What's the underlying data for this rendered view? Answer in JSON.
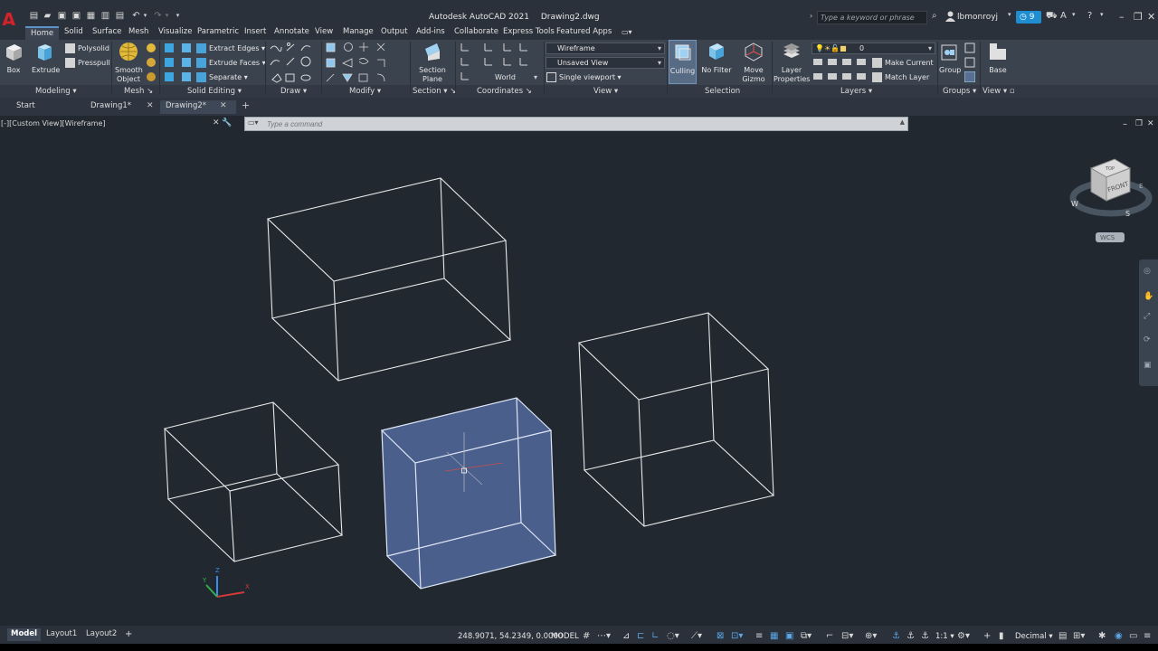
{
  "title_bar": {
    "app_name": "Autodesk AutoCAD 2021",
    "document": "Drawing2.dwg",
    "search_placeholder": "Type a keyword or phrase",
    "user": "lbmonroyj",
    "notifications": "9"
  },
  "ribbon_tabs": [
    "Home",
    "Solid",
    "Surface",
    "Mesh",
    "Visualize",
    "Parametric",
    "Insert",
    "Annotate",
    "View",
    "Manage",
    "Output",
    "Add-ins",
    "Collaborate",
    "Express Tools",
    "Featured Apps"
  ],
  "ribbon": {
    "modeling": {
      "title": "Modeling",
      "box": "Box",
      "extrude": "Extrude",
      "polysolid": "Polysolid",
      "presspull": "Presspull"
    },
    "mesh": {
      "title": "Mesh",
      "smooth_object_1": "Smooth",
      "smooth_object_2": "Object"
    },
    "solid_editing": {
      "title": "Solid Editing",
      "extract_edges": "Extract Edges",
      "extrude_faces": "Extrude Faces",
      "separate": "Separate"
    },
    "draw": {
      "title": "Draw"
    },
    "modify": {
      "title": "Modify"
    },
    "section": {
      "title": "Section",
      "section_plane_1": "Section",
      "section_plane_2": "Plane"
    },
    "coordinates": {
      "title": "Coordinates",
      "ucs": "World"
    },
    "view": {
      "title": "View",
      "visual_style": "Wireframe",
      "named_view": "Unsaved View",
      "viewport": "Single viewport"
    },
    "selection": {
      "title": "Selection",
      "culling": "Culling",
      "no_filter": "No Filter",
      "move_gizmo_1": "Move",
      "move_gizmo_2": "Gizmo"
    },
    "layers": {
      "title": "Layers",
      "layer_properties_1": "Layer",
      "layer_properties_2": "Properties",
      "current_layer": "0",
      "make_current": "Make Current",
      "match_layer": "Match Layer"
    },
    "groups": {
      "title": "Groups",
      "group": "Group"
    },
    "view2": {
      "title": "View",
      "base": "Base"
    }
  },
  "doc_tabs": [
    "Start",
    "Drawing1*",
    "Drawing2*"
  ],
  "viewport": {
    "label": "[-][Custom View][Wireframe]",
    "command_placeholder": "Type a command",
    "viewcube_face": "FRONT",
    "viewcube_top": "TOP",
    "wcs": "WCS",
    "compass": {
      "w": "W",
      "s": "S",
      "e": "E"
    },
    "axis": {
      "x": "X",
      "y": "Y",
      "z": "Z"
    }
  },
  "status_bar": {
    "layouts": [
      "Model",
      "Layout1",
      "Layout2"
    ],
    "coordinates": "248.9071, 54.2349, 0.0000",
    "space": "MODEL",
    "scale": "1:1",
    "units": "Decimal"
  },
  "colors": {
    "selected_fill": "#4e6494",
    "wire": "#e6e6e6",
    "background": "#212830"
  }
}
